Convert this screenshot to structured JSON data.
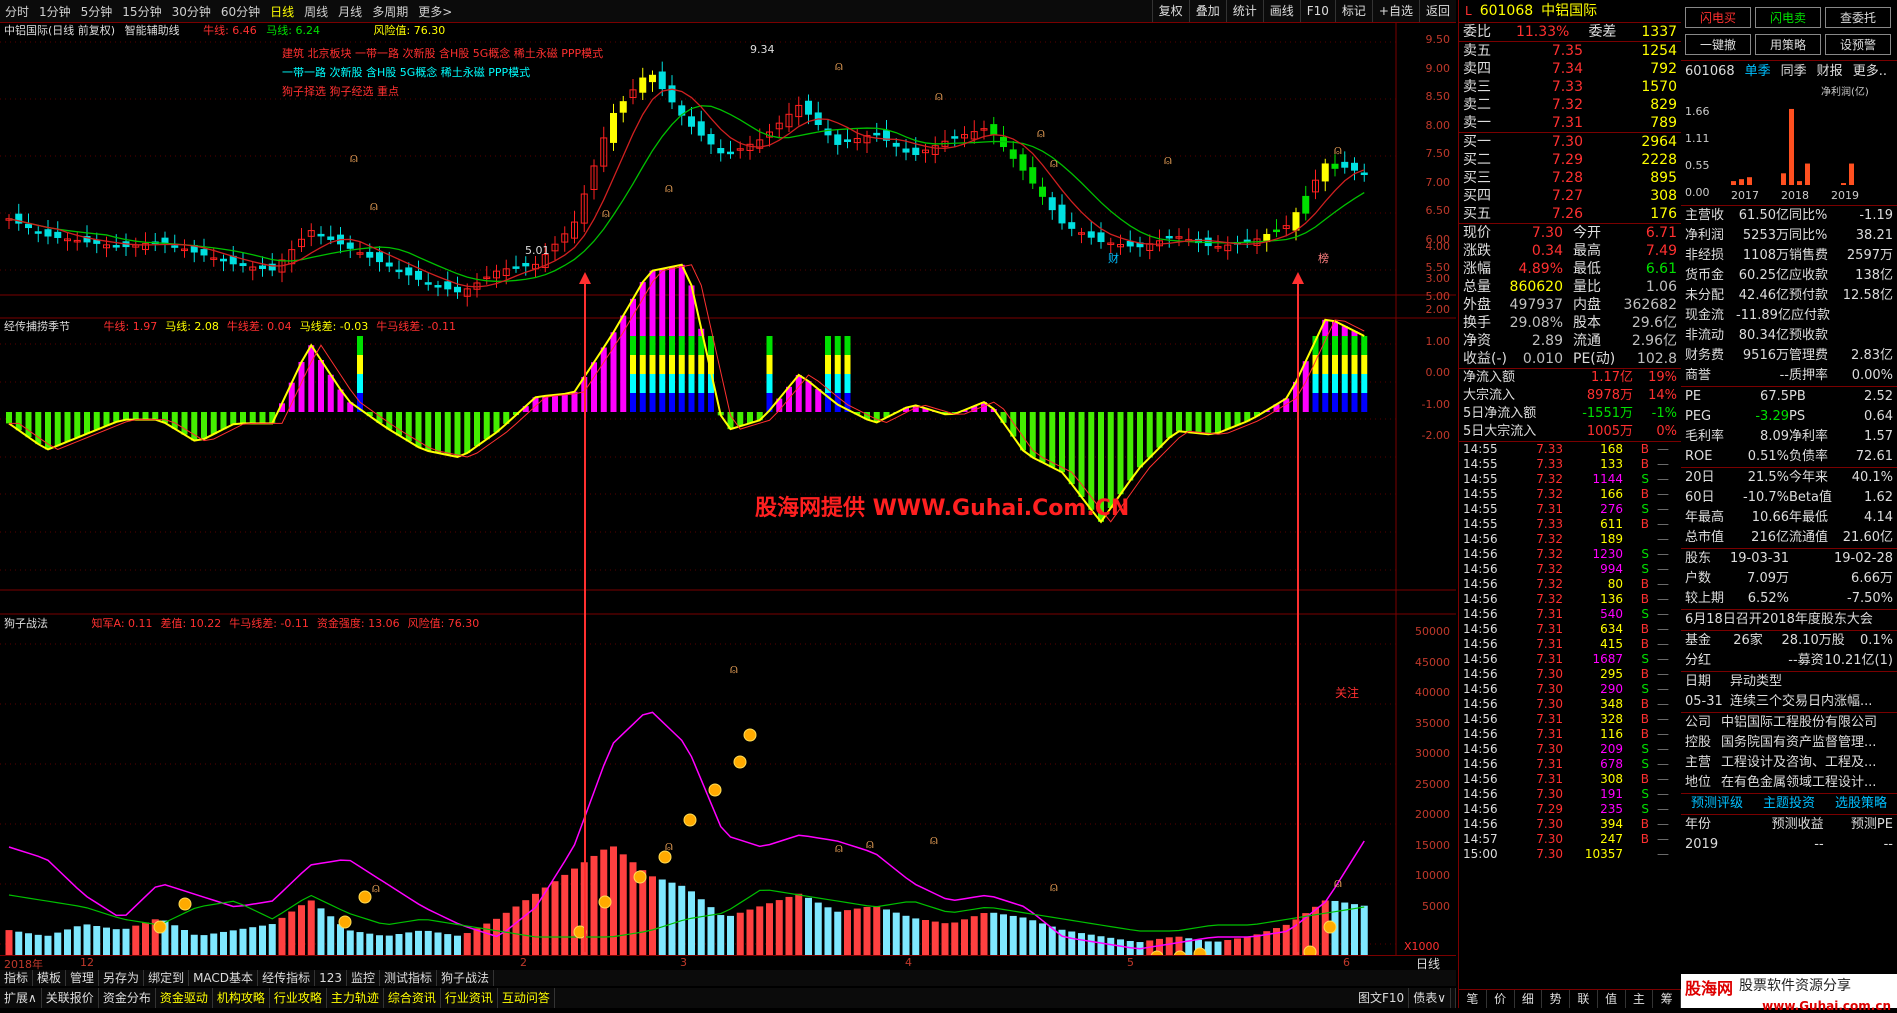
{
  "toolbar": {
    "periods": [
      "分时",
      "1分钟",
      "5分钟",
      "15分钟",
      "30分钟",
      "60分钟",
      "日线",
      "周线",
      "月线",
      "多周期",
      "更多>"
    ],
    "active": "日线",
    "right_buttons": [
      "复权",
      "叠加",
      "统计",
      "画线",
      "F10",
      "标记",
      "+自选",
      "返回"
    ]
  },
  "panel1": {
    "title": "中铝国际(日线 前复权)",
    "indicator": "智能辅助线",
    "bull_line": "牛线: 6.46",
    "horse_line": "马线: 6.24",
    "risk": "风险值: 76.30",
    "tags": [
      "建筑 北京板块 一带一路 次新股 含H股 5G概念 稀土永磁 PPP模式",
      "一带一路 次新股 含H股 5G概念 稀土永磁 PPP模式",
      "狗子择选 狗子经选 重点"
    ],
    "high_label": "9.34",
    "low_label": "5.01",
    "axis": [
      "9.50",
      "9.00",
      "8.50",
      "8.00",
      "7.50",
      "7.00",
      "6.50",
      "6.00",
      "5.50",
      "5.00"
    ],
    "marks": [
      "财",
      "榜"
    ]
  },
  "panel2": {
    "title": "经传捕捞季节",
    "params": [
      "牛线: 1.97",
      "马线: 2.08",
      "牛线差: 0.04",
      "马线差: -0.03",
      "牛马线差: -0.11"
    ],
    "axis": [
      "4.00",
      "3.00",
      "2.00",
      "1.00",
      "0.00",
      "-1.00",
      "-2.00"
    ],
    "watermark": "股海网提供 WWW.Guhai.Com.CN"
  },
  "panel3": {
    "title": "狗子战法",
    "params": [
      "知军A: 0.11",
      "差值: 10.22",
      "牛马线差: -0.11",
      "资金强度: 13.06",
      "风险值: 76.30"
    ],
    "axis": [
      "50000",
      "45000",
      "40000",
      "35000",
      "30000",
      "25000",
      "20000",
      "15000",
      "10000",
      "5000"
    ],
    "unit": "X1000",
    "focus": "关注"
  },
  "date_axis": [
    "2018年",
    "12",
    "2",
    "3",
    "4",
    "5",
    "6"
  ],
  "right_axis_label": "日线",
  "tabs_row": [
    "指标",
    "模板",
    "管理",
    "另存为",
    "绑定到",
    "MACD基本",
    "经传指标",
    "123",
    "监控",
    "测试指标",
    "狗子战法"
  ],
  "bottom_row": [
    "扩展∧",
    "关联报价",
    "资金分布",
    "资金驱动",
    "机构攻略",
    "行业攻略",
    "主力轨迹",
    "综合资讯",
    "行业资讯",
    "互动问答"
  ],
  "bottom_right": [
    "图文F10",
    "债表∨"
  ],
  "quote": {
    "code": "601068",
    "name": "中铝国际",
    "wei_bi": "11.33%",
    "wei_cha": "1337",
    "asks": [
      [
        "卖五",
        "7.35",
        "1254"
      ],
      [
        "卖四",
        "7.34",
        "792"
      ],
      [
        "卖三",
        "7.33",
        "1570"
      ],
      [
        "卖二",
        "7.32",
        "829"
      ],
      [
        "卖一",
        "7.31",
        "789"
      ]
    ],
    "bids": [
      [
        "买一",
        "7.30",
        "2964"
      ],
      [
        "买二",
        "7.29",
        "2228"
      ],
      [
        "买三",
        "7.28",
        "895"
      ],
      [
        "买四",
        "7.27",
        "308"
      ],
      [
        "买五",
        "7.26",
        "176"
      ]
    ],
    "stats": [
      [
        "现价",
        "7.30",
        "今开",
        "6.71"
      ],
      [
        "涨跌",
        "0.34",
        "最高",
        "7.49"
      ],
      [
        "涨幅",
        "4.89%",
        "最低",
        "6.61"
      ],
      [
        "总量",
        "860620",
        "量比",
        "1.06"
      ],
      [
        "外盘",
        "497937",
        "内盘",
        "362682"
      ],
      [
        "换手",
        "29.08%",
        "股本",
        "29.6亿"
      ],
      [
        "净资",
        "2.89",
        "流通",
        "2.96亿"
      ],
      [
        "收益(-)",
        "0.010",
        "PE(动)",
        "102.8"
      ]
    ],
    "flows": [
      [
        "净流入额",
        "1.17亿",
        "19%"
      ],
      [
        "大宗流入",
        "8978万",
        "14%"
      ],
      [
        "5日净流入额",
        "-1551万",
        "-1%"
      ],
      [
        "5日大宗流入",
        "1005万",
        "0%"
      ]
    ],
    "ticks": [
      [
        "14:55",
        "7.33",
        "168",
        "B"
      ],
      [
        "14:55",
        "7.33",
        "133",
        "B"
      ],
      [
        "14:55",
        "7.32",
        "1144",
        "S"
      ],
      [
        "14:55",
        "7.32",
        "166",
        "B"
      ],
      [
        "14:55",
        "7.31",
        "276",
        "S"
      ],
      [
        "14:55",
        "7.33",
        "611",
        "B"
      ],
      [
        "14:56",
        "7.32",
        "189",
        ""
      ],
      [
        "14:56",
        "7.32",
        "1230",
        "S"
      ],
      [
        "14:56",
        "7.32",
        "994",
        "S"
      ],
      [
        "14:56",
        "7.32",
        "80",
        "B"
      ],
      [
        "14:56",
        "7.32",
        "136",
        "B"
      ],
      [
        "14:56",
        "7.31",
        "540",
        "S"
      ],
      [
        "14:56",
        "7.31",
        "634",
        "B"
      ],
      [
        "14:56",
        "7.31",
        "415",
        "B"
      ],
      [
        "14:56",
        "7.31",
        "1687",
        "S"
      ],
      [
        "14:56",
        "7.30",
        "295",
        "B"
      ],
      [
        "14:56",
        "7.30",
        "290",
        "S"
      ],
      [
        "14:56",
        "7.30",
        "348",
        "B"
      ],
      [
        "14:56",
        "7.31",
        "328",
        "B"
      ],
      [
        "14:56",
        "7.31",
        "116",
        "B"
      ],
      [
        "14:56",
        "7.30",
        "209",
        "S"
      ],
      [
        "14:56",
        "7.31",
        "678",
        "S"
      ],
      [
        "14:56",
        "7.31",
        "308",
        "B"
      ],
      [
        "14:56",
        "7.30",
        "191",
        "S"
      ],
      [
        "14:56",
        "7.29",
        "235",
        "S"
      ],
      [
        "14:56",
        "7.30",
        "394",
        "B"
      ],
      [
        "14:57",
        "7.30",
        "247",
        "B"
      ],
      [
        "15:00",
        "7.30",
        "10357",
        ""
      ]
    ],
    "bottom_tabs": [
      "笔",
      "价",
      "细",
      "势",
      "联",
      "值",
      "主",
      "筹"
    ]
  },
  "f10": {
    "buttons": [
      "闪电买",
      "闪电卖",
      "查委托",
      "一键撤",
      "用策略",
      "设预警"
    ],
    "code": "601068",
    "tabs": [
      "单季",
      "同季",
      "财报",
      "更多.."
    ],
    "chart": {
      "type": "bar",
      "ylabel": "净利润(亿)",
      "yticks": [
        "1.66",
        "1.11",
        "0.55",
        "0.00"
      ],
      "years": [
        "2017",
        "2018",
        "2019"
      ]
    },
    "fin": [
      [
        "主营收",
        "61.50亿",
        "同比%",
        "-1.19"
      ],
      [
        "净利润",
        "5253万",
        "同比%",
        "38.21"
      ],
      [
        "非经损",
        "1108万",
        "销售费",
        "2597万"
      ],
      [
        "货币金",
        "60.25亿",
        "应收款",
        "138亿"
      ],
      [
        "未分配",
        "42.46亿",
        "预付款",
        "12.58亿"
      ],
      [
        "现金流",
        "-11.89亿",
        "应付款",
        ""
      ],
      [
        "非流动",
        "80.34亿",
        "预收款",
        ""
      ],
      [
        "财务费",
        "9516万",
        "管理费",
        "2.83亿"
      ],
      [
        "商誉",
        "--",
        "质押率",
        "0.00%"
      ]
    ],
    "val": [
      [
        "PE",
        "67.5",
        "PB",
        "2.52"
      ],
      [
        "PEG",
        "-3.29",
        "PS",
        "0.64"
      ],
      [
        "毛利率",
        "8.09",
        "净利率",
        "1.57"
      ],
      [
        "ROE",
        "0.51%",
        "负债率",
        "72.61"
      ]
    ],
    "perf": [
      [
        "20日",
        "21.5%",
        "今年来",
        "40.1%"
      ],
      [
        "60日",
        "-10.7%",
        "Beta值",
        "1.62"
      ],
      [
        "年最高",
        "10.66",
        "年最低",
        "4.14"
      ],
      [
        "总市值",
        "216亿",
        "流通值",
        "21.60亿"
      ]
    ],
    "holders": [
      [
        "股东",
        "19-03-31",
        "",
        "19-02-28"
      ],
      [
        "户数",
        "7.09万",
        "",
        "6.66万"
      ],
      [
        "较上期",
        "6.52%",
        "",
        "-7.50%"
      ]
    ],
    "notice": "6月18日召开2018年度股东大会",
    "fund": [
      "基金",
      "26家",
      "28.10万股",
      "0.1%"
    ],
    "dividend": [
      "分红",
      "--募资",
      "10.21亿(1)"
    ],
    "events_hdr": [
      "日期",
      "异动类型"
    ],
    "event": [
      "05-31",
      "连续三个交易日内涨幅..."
    ],
    "company": [
      [
        "公司",
        "中铝国际工程股份有限公司"
      ],
      [
        "控股",
        "国务院国有资产监督管理..."
      ],
      [
        "主营",
        "工程设计及咨询、工程及..."
      ],
      [
        "地位",
        "在有色金属领域工程设计..."
      ]
    ],
    "links": [
      "预测评级",
      "主题投资",
      "选股策略"
    ],
    "forecast_hdr": [
      "年份",
      "预测收益",
      "预测PE"
    ],
    "forecast": [
      "2019",
      "--",
      "--"
    ],
    "logo": "股海网",
    "logo_sub": "股票软件资源分享",
    "url": "www.Guhai.com.cn"
  }
}
